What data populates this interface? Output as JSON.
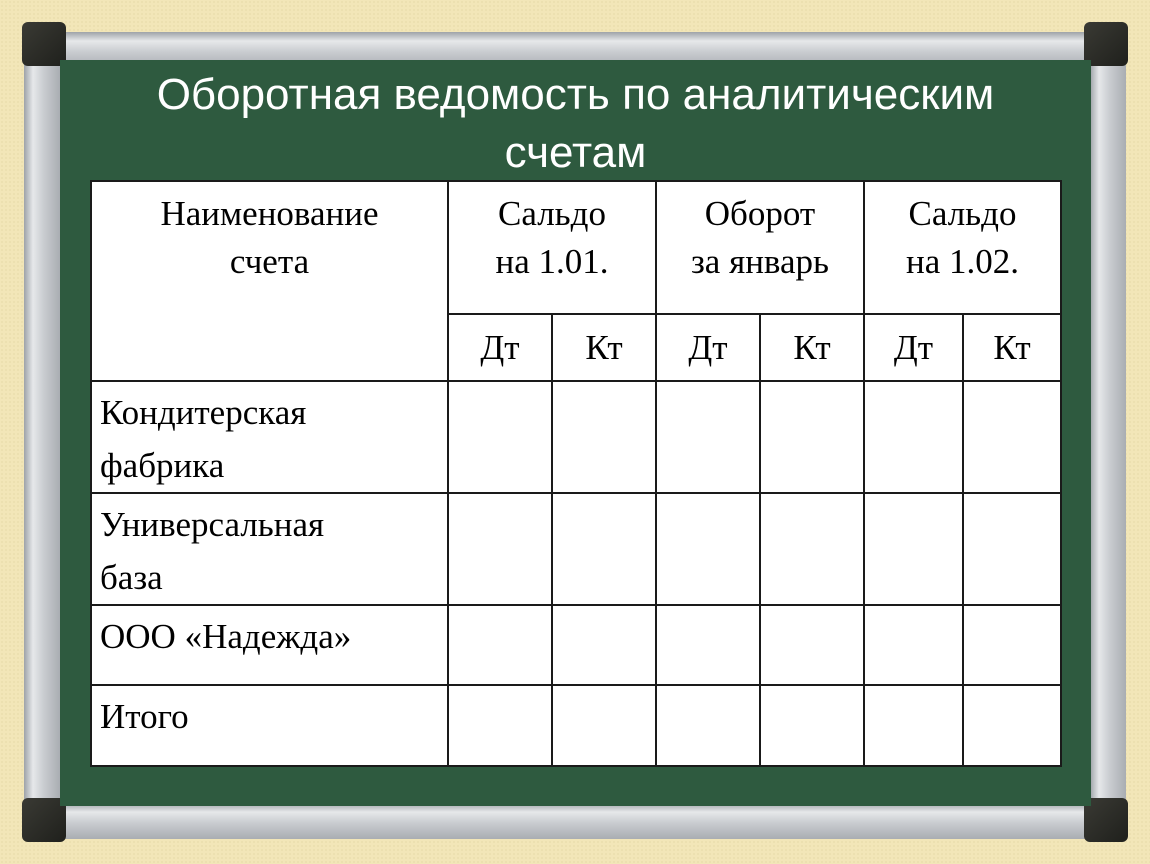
{
  "title_line1": "Оборотная ведомость по аналитическим",
  "title_line2": "счетам",
  "table": {
    "header": {
      "name_col": [
        "Наименование",
        "счета"
      ],
      "groups": [
        {
          "line1": "Сальдо",
          "line2": "на 1.01."
        },
        {
          "line1": "Оборот",
          "line2": "за январь"
        },
        {
          "line1": "Сальдо",
          "line2": "на 1.02."
        }
      ],
      "sub": [
        "Дт",
        "Кт",
        "Дт",
        "Кт",
        "Дт",
        "Кт"
      ]
    },
    "rows": [
      {
        "line1": "Кондитерская",
        "line2": "фабрика",
        "values": [
          "",
          "",
          "",
          "",
          "",
          ""
        ]
      },
      {
        "line1": "Универсальная",
        "line2": "база",
        "values": [
          "",
          "",
          "",
          "",
          "",
          ""
        ]
      },
      {
        "line1": "ООО «Надежда»",
        "line2": "",
        "values": [
          "",
          "",
          "",
          "",
          "",
          ""
        ]
      },
      {
        "line1": "Итого",
        "line2": "",
        "values": [
          "",
          "",
          "",
          "",
          "",
          ""
        ]
      }
    ]
  }
}
